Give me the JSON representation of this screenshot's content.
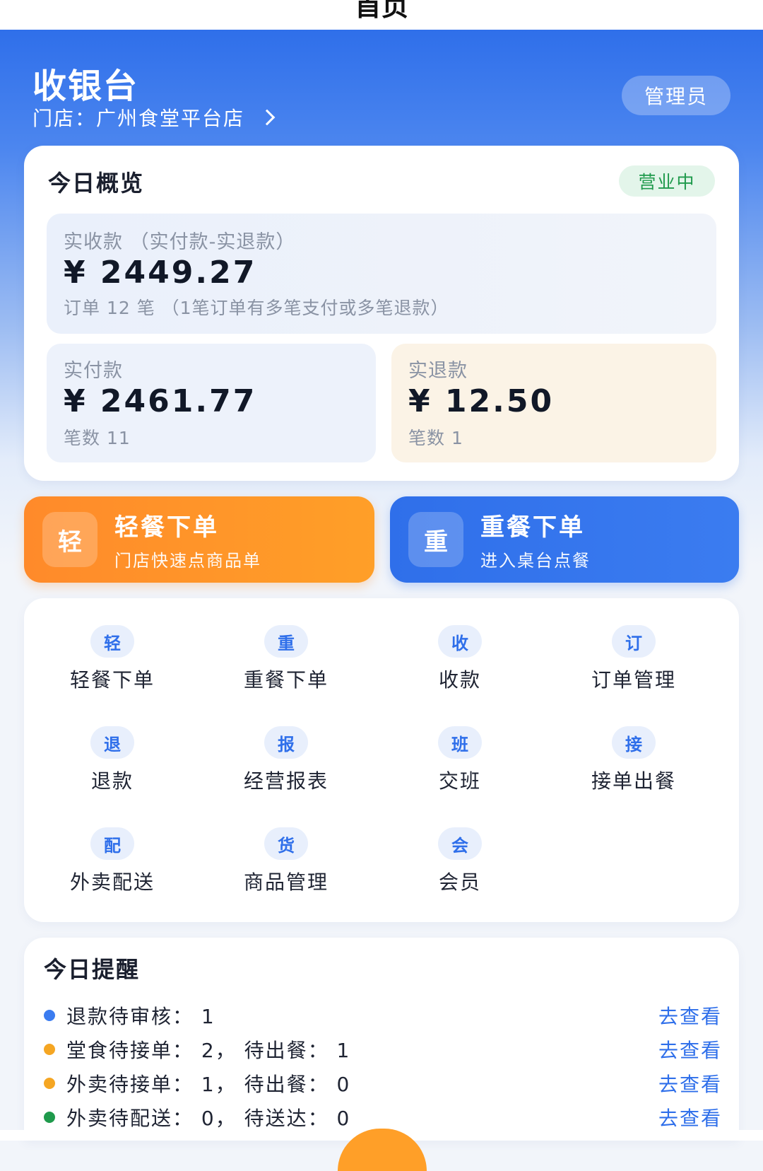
{
  "page": {
    "nav_title": "首页"
  },
  "header": {
    "title": "收银台",
    "store_label": "门店：",
    "store_name": "广州食堂平台店",
    "role": "管理员"
  },
  "overview": {
    "title": "今日概览",
    "status": "营业中",
    "net": {
      "label": "实收款 （实付款-实退款）",
      "amount": "¥ 2449.27",
      "sub": "订单 12 笔 （1笔订单有多笔支付或多笔退款）"
    },
    "paid": {
      "label": "实付款",
      "amount": "¥ 2461.77",
      "sub": "笔数 11"
    },
    "refund": {
      "label": "实退款",
      "amount": "¥ 12.50",
      "sub": "笔数 1"
    }
  },
  "actions": {
    "light": {
      "icon": "轻",
      "title": "轻餐下单",
      "sub": "门店快速点商品单"
    },
    "heavy": {
      "icon": "重",
      "title": "重餐下单",
      "sub": "进入桌台点餐"
    }
  },
  "grid": [
    {
      "icon": "轻",
      "label": "轻餐下单"
    },
    {
      "icon": "重",
      "label": "重餐下单"
    },
    {
      "icon": "收",
      "label": "收款"
    },
    {
      "icon": "订",
      "label": "订单管理"
    },
    {
      "icon": "退",
      "label": "退款"
    },
    {
      "icon": "报",
      "label": "经营报表"
    },
    {
      "icon": "班",
      "label": "交班"
    },
    {
      "icon": "接",
      "label": "接单出餐"
    },
    {
      "icon": "配",
      "label": "外卖配送"
    },
    {
      "icon": "货",
      "label": "商品管理"
    },
    {
      "icon": "会",
      "label": "会员"
    }
  ],
  "reminders": {
    "title": "今日提醒",
    "items": [
      {
        "text": "退款待审核：  1",
        "link": "去查看",
        "color": "#3b7cf0"
      },
      {
        "text": "堂食待接单：  2，  待出餐：  1",
        "link": "去查看",
        "color": "#f5a623"
      },
      {
        "text": "外卖待接单：  1，  待出餐：  0",
        "link": "去查看",
        "color": "#f5a623"
      },
      {
        "text": "外卖待配送：  0，  待送达：  0",
        "link": "去查看",
        "color": "#1f9a4c"
      }
    ]
  },
  "colors": {
    "primary": "#2f6fea",
    "accent_orange": "#ff9a28",
    "status_green": "#1f9a4c"
  }
}
